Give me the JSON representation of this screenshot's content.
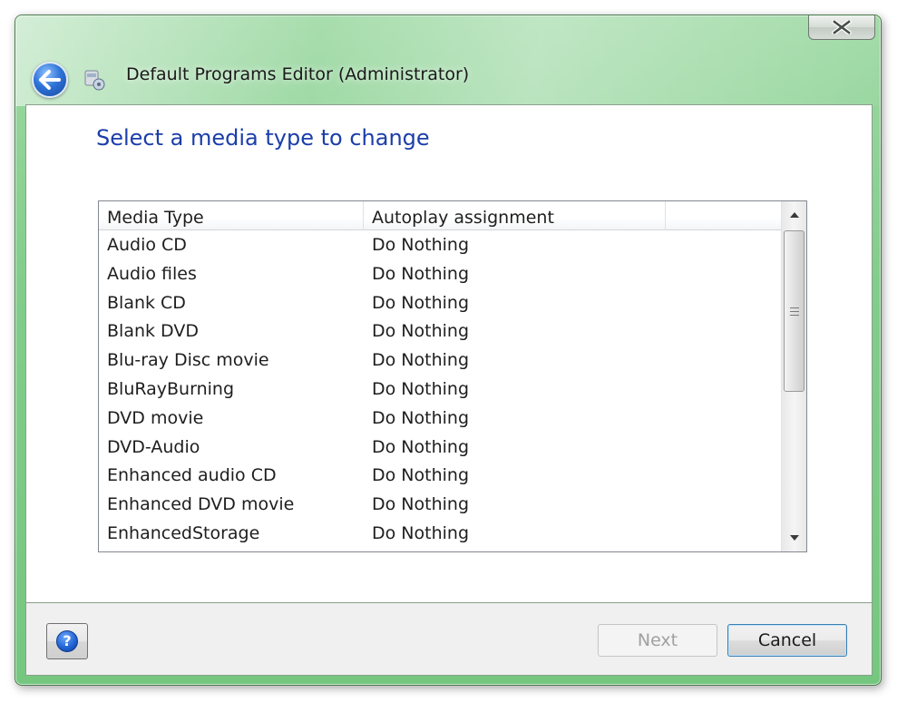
{
  "window": {
    "title": "Default Programs Editor (Administrator)"
  },
  "page": {
    "heading": "Select a media type to change"
  },
  "list": {
    "columns": [
      "Media Type",
      "Autoplay assignment"
    ],
    "rows": [
      {
        "media": "Audio CD",
        "assignment": "Do Nothing"
      },
      {
        "media": "Audio files",
        "assignment": "Do Nothing"
      },
      {
        "media": "Blank CD",
        "assignment": "Do Nothing"
      },
      {
        "media": "Blank DVD",
        "assignment": "Do Nothing"
      },
      {
        "media": "Blu-ray Disc movie",
        "assignment": "Do Nothing"
      },
      {
        "media": "BluRayBurning",
        "assignment": "Do Nothing"
      },
      {
        "media": "DVD movie",
        "assignment": "Do Nothing"
      },
      {
        "media": "DVD-Audio",
        "assignment": "Do Nothing"
      },
      {
        "media": "Enhanced audio CD",
        "assignment": "Do Nothing"
      },
      {
        "media": "Enhanced DVD movie",
        "assignment": "Do Nothing"
      },
      {
        "media": "EnhancedStorage",
        "assignment": "Do Nothing"
      }
    ]
  },
  "footer": {
    "next_label": "Next",
    "cancel_label": "Cancel"
  },
  "icons": {
    "close": "close-icon",
    "back": "back-arrow-icon",
    "app": "app-icon",
    "help": "help-icon",
    "scroll_up": "scroll-up-arrow-icon",
    "scroll_down": "scroll-down-arrow-icon"
  },
  "colors": {
    "chrome": "#82cd8b",
    "heading": "#1b3ea8",
    "accent": "#3c7fb1"
  }
}
